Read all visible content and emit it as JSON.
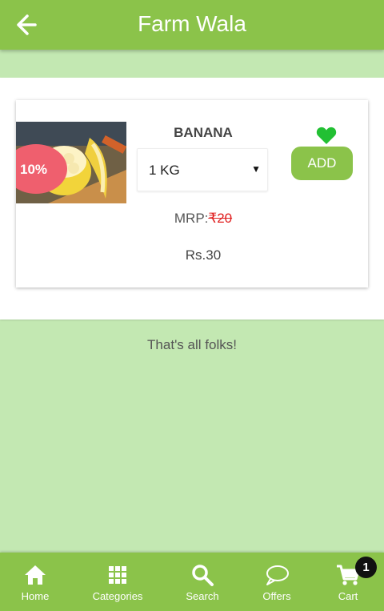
{
  "header": {
    "title": "Farm Wala",
    "back_icon": "arrow-left-icon"
  },
  "product": {
    "name": "BANANA",
    "discount": "10%",
    "quantity": "1 KG",
    "add_label": "ADD",
    "wishlist_icon": "heart-icon",
    "mrp_label": "MRP:",
    "mrp_value": "₹20",
    "price": "Rs.30",
    "image_icon": "banana-photo"
  },
  "footer_text": "That's all folks!",
  "nav": {
    "items": [
      {
        "label": "Home",
        "icon": "home-icon"
      },
      {
        "label": "Categories",
        "icon": "grid-icon"
      },
      {
        "label": "Search",
        "icon": "search-icon"
      },
      {
        "label": "Offers",
        "icon": "chat-bubble-icon"
      },
      {
        "label": "Cart",
        "icon": "cart-icon"
      }
    ],
    "cart_count": "1"
  },
  "colors": {
    "primary": "#8bc34a",
    "background": "#c3e8b2",
    "discount": "#ef5f6e",
    "heart": "#22c033",
    "strike_price": "#e02020"
  }
}
